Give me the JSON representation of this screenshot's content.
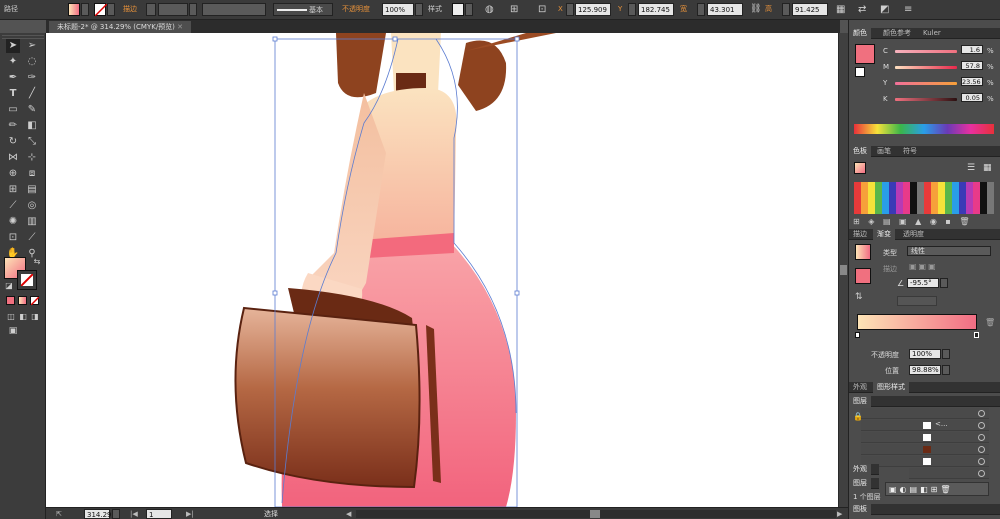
{
  "control_bar": {
    "object_label": "路径",
    "stroke_label": "描边",
    "stroke_style": "基本",
    "opacity_label": "不透明度",
    "opacity_value": "100%",
    "style_label": "样式",
    "x_label": "X",
    "x_value": "125.909",
    "y_label": "Y",
    "y_value": "182.745",
    "w_label": "宽",
    "w_value": "43.301",
    "h_label": "高",
    "h_value": "91.425"
  },
  "document": {
    "tab_title": "未标题-2* @ 314.29% (CMYK/预览)"
  },
  "status_bar": {
    "zoom": "314.29",
    "artboard": "1",
    "tool_name": "选择"
  },
  "color_panel": {
    "tabs": [
      "颜色",
      "颜色参考",
      "Kuler"
    ],
    "sliders": [
      {
        "label": "C",
        "value": "1.6",
        "unit": "%"
      },
      {
        "label": "M",
        "value": "57.8",
        "unit": "%"
      },
      {
        "label": "Y",
        "value": "23.56",
        "unit": "%"
      },
      {
        "label": "K",
        "value": "0.05",
        "unit": "%"
      }
    ]
  },
  "swatches_panel": {
    "tabs": [
      "色板",
      "画笔",
      "符号"
    ]
  },
  "gradient_panel": {
    "tabs": [
      "描边",
      "渐变",
      "透明度"
    ],
    "type_label": "类型",
    "type_value": "线性",
    "stroke_label": "描边",
    "angle_value": "-95.5°",
    "opacity_label": "不透明度",
    "opacity_value": "100%",
    "location_label": "位置",
    "location_value": "98.88%"
  },
  "appearance_panel": {
    "tabs": [
      "外观",
      "图形样式"
    ]
  },
  "layers_panel": {
    "tab": "图层",
    "sub_label": "不",
    "row_labels": [
      "<...",
      "<..."
    ],
    "lower_tabs": [
      "外观"
    ],
    "lower_tab2": "图层",
    "count_label": "1 个图层"
  },
  "lower_panel": {
    "tab": "图板"
  },
  "icons": [
    "selection-tool-icon",
    "direct-selection-tool-icon",
    "magic-wand-icon",
    "lasso-icon",
    "pen-icon",
    "type-icon",
    "line-icon",
    "rectangle-icon",
    "paintbrush-icon",
    "pencil-icon",
    "rotate-icon",
    "scale-icon",
    "width-icon",
    "free-transform-icon",
    "shape-builder-icon",
    "gradient-icon",
    "eyedropper-icon",
    "blend-icon",
    "symbol-sprayer-icon",
    "column-graph-icon",
    "artboard-icon",
    "slice-icon",
    "hand-icon",
    "zoom-icon",
    "fill-stroke-icon",
    "swap-icon",
    "eye-icon",
    "lock-icon",
    "trash-icon",
    "new-layer-icon"
  ],
  "colors": {
    "fill_pink": "#f0707f",
    "gradient_start": "#fde4b6",
    "gradient_end": "#f26d84",
    "ui_dark": "#3a3a3a",
    "artboard": "#ffffff"
  }
}
